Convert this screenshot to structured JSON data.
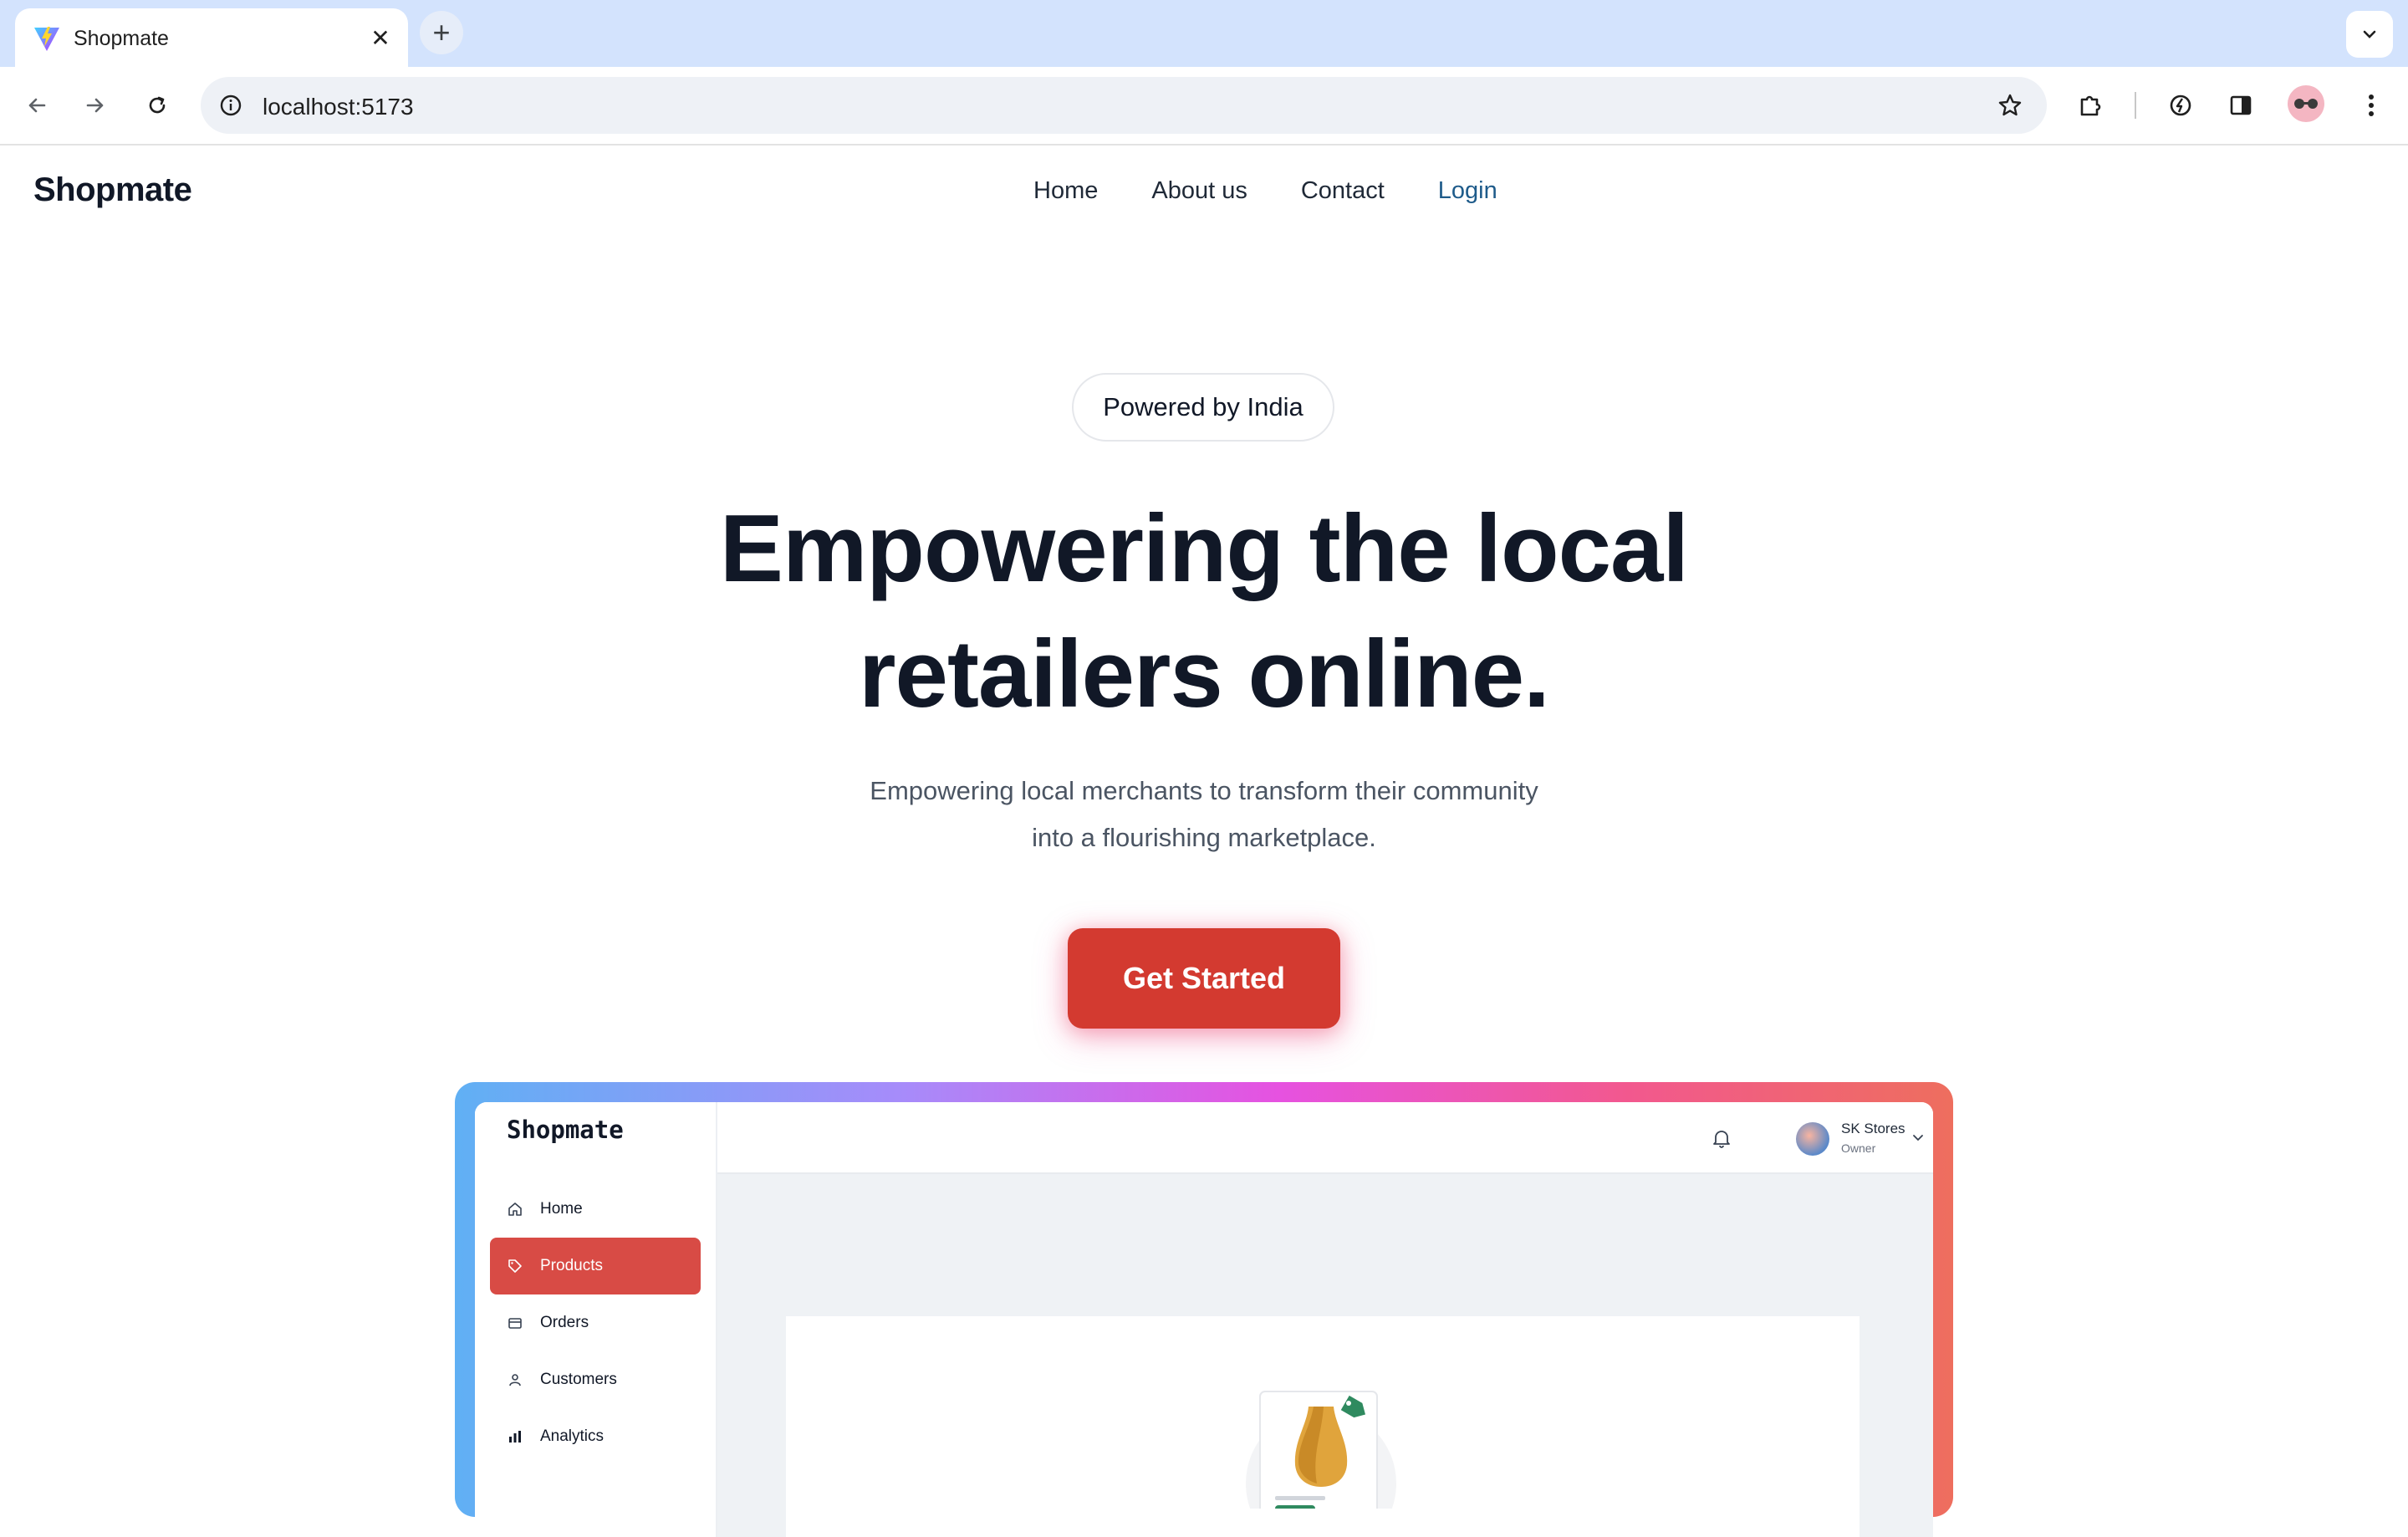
{
  "browser": {
    "tab_title": "Shopmate",
    "url": "localhost:5173",
    "favicon": "vite-logo-icon",
    "icons": [
      "back-icon",
      "forward-icon",
      "reload-icon",
      "site-info-icon",
      "bookmark-star-icon",
      "extensions-icon",
      "performance-icon",
      "side-panel-icon",
      "profile-avatar",
      "menu-dots-icon"
    ]
  },
  "site": {
    "logo": "Shopmate",
    "nav": {
      "home": "Home",
      "about": "About us",
      "contact": "Contact",
      "login": "Login"
    }
  },
  "hero": {
    "badge": "Powered by India",
    "title_line1": "Empowering the local",
    "title_line2": "retailers online.",
    "subtitle_line1": "Empowering local merchants to transform their community",
    "subtitle_line2": "into a flourishing marketplace.",
    "cta": "Get Started"
  },
  "preview": {
    "logo": "Shopmate",
    "sidebar": [
      {
        "label": "Home",
        "icon": "home-icon",
        "active": false
      },
      {
        "label": "Products",
        "icon": "tag-icon",
        "active": true
      },
      {
        "label": "Orders",
        "icon": "box-icon",
        "active": false
      },
      {
        "label": "Customers",
        "icon": "person-icon",
        "active": false
      },
      {
        "label": "Analytics",
        "icon": "bar-chart-icon",
        "active": false
      }
    ],
    "user": {
      "name": "SK Stores",
      "role": "Owner"
    }
  },
  "colors": {
    "accent": "#d33a30",
    "link": "#1e5b8a",
    "sidebar_active": "#d84b45",
    "tabstrip": "#d3e3fd"
  }
}
